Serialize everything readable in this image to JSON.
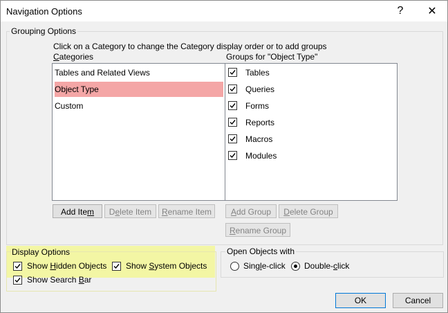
{
  "window": {
    "title": "Navigation Options",
    "help_glyph": "?",
    "close_glyph": "✕"
  },
  "grouping": {
    "legend": "Grouping Options",
    "instruction": "Click on a Category to change the Category display order or to add groups",
    "categories_label": "Categories",
    "groups_label": "Groups for \"Object Type\"",
    "categories": [
      {
        "label": "Tables and Related Views"
      },
      {
        "label": "Object Type",
        "selected": true
      },
      {
        "label": "Custom"
      }
    ],
    "groups": [
      {
        "label": "Tables",
        "checked": true
      },
      {
        "label": "Queries",
        "checked": true
      },
      {
        "label": "Forms",
        "checked": true
      },
      {
        "label": "Reports",
        "checked": true
      },
      {
        "label": "Macros",
        "checked": true
      },
      {
        "label": "Modules",
        "checked": true
      }
    ],
    "buttons": {
      "add_item": "Add Item",
      "delete_item": "Delete Item",
      "rename_item": "Rename Item",
      "add_group": "Add Group",
      "delete_group": "Delete Group",
      "rename_group": "Rename Group"
    }
  },
  "display": {
    "legend": "Display Options",
    "show_hidden": {
      "label": "Show Hidden Objects",
      "checked": true
    },
    "show_system": {
      "label": "Show System Objects",
      "checked": true
    },
    "show_search": {
      "label": "Show Search Bar",
      "checked": true
    }
  },
  "open_objects": {
    "legend": "Open Objects with",
    "single": {
      "label": "Single-click",
      "selected": false
    },
    "double": {
      "label": "Double-click",
      "selected": true
    }
  },
  "footer": {
    "ok": "OK",
    "cancel": "Cancel"
  },
  "colors": {
    "selected_row": "#f4a6a6",
    "highlight": "#f3f6a4",
    "focus_border": "#0078d7"
  }
}
